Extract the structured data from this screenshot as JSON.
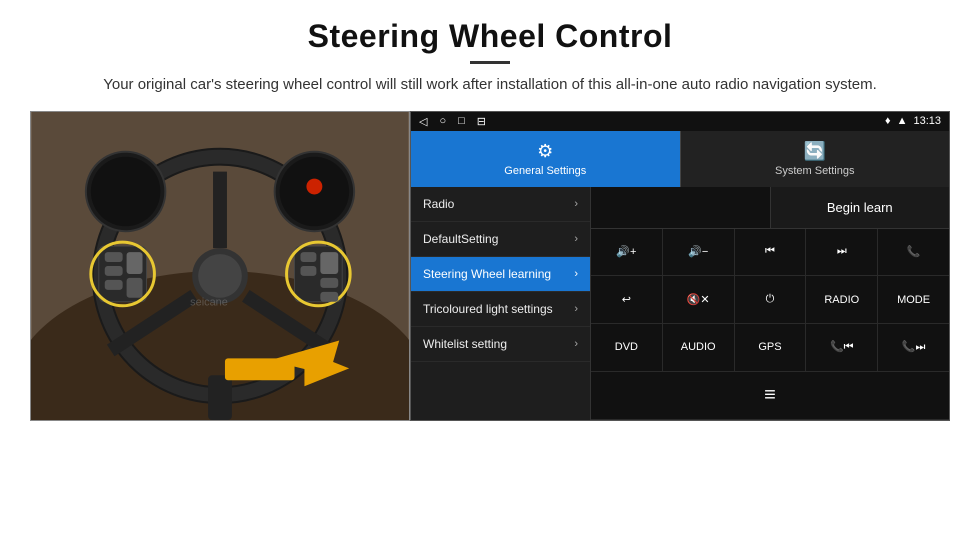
{
  "header": {
    "title": "Steering Wheel Control",
    "subtitle": "Your original car's steering wheel control will still work after installation of this all-in-one auto radio navigation system."
  },
  "status_bar": {
    "time": "13:13",
    "nav_icons": [
      "◁",
      "○",
      "□",
      "⊟"
    ]
  },
  "tabs": [
    {
      "id": "general",
      "label": "General Settings",
      "icon": "⚙",
      "active": true
    },
    {
      "id": "system",
      "label": "System Settings",
      "icon": "🔄",
      "active": false
    }
  ],
  "menu_items": [
    {
      "label": "Radio",
      "active": false
    },
    {
      "label": "DefaultSetting",
      "active": false
    },
    {
      "label": "Steering Wheel learning",
      "active": true
    },
    {
      "label": "Tricoloured light settings",
      "active": false
    },
    {
      "label": "Whitelist setting",
      "active": false
    }
  ],
  "begin_learn": "Begin learn",
  "control_buttons": {
    "row1": [
      "🔇+",
      "🔇−",
      "⏮",
      "⏭",
      "📞"
    ],
    "row2": [
      "↩",
      "🔇✕",
      "⏻",
      "RADIO",
      "MODE"
    ],
    "row3": [
      "DVD",
      "AUDIO",
      "GPS",
      "📞⏮",
      "📞⏭"
    ],
    "row4": [
      "≡"
    ]
  },
  "control_buttons_display": {
    "row1": [
      "vol+",
      "vol−",
      "prev",
      "next",
      "call"
    ],
    "row2": [
      "hook",
      "mute",
      "power",
      "RADIO",
      "MODE"
    ],
    "row3": [
      "DVD",
      "AUDIO",
      "GPS",
      "tel+prev",
      "tel+next"
    ],
    "row4": [
      "menu"
    ]
  }
}
